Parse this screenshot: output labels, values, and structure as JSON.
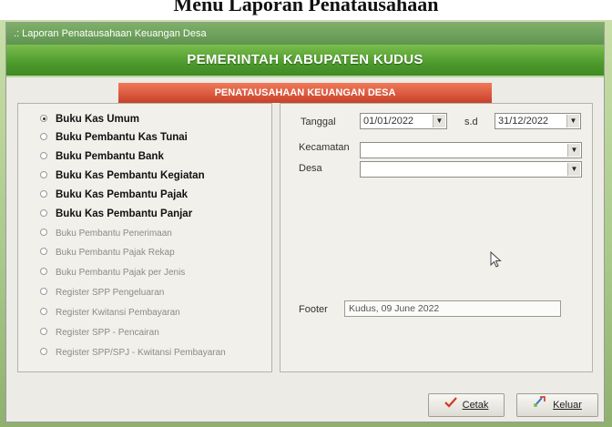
{
  "document_title": "Menu Laporan Penatausahaan",
  "window": {
    "title": ".: Laporan Penatausahaan Keuangan Desa",
    "banner": "PEMERINTAH KABUPATEN KUDUS",
    "subbanner": "PENATAUSAHAAN KEUANGAN DESA"
  },
  "report_options": [
    {
      "label": "Buku Kas Umum",
      "selected": true
    },
    {
      "label": "Buku Pembantu Kas Tunai",
      "selected": false
    },
    {
      "label": "Buku Pembantu Bank",
      "selected": false
    },
    {
      "label": "Buku Kas Pembantu Kegiatan",
      "selected": false
    },
    {
      "label": "Buku Kas Pembantu Pajak",
      "selected": false
    },
    {
      "label": "Buku Kas Pembantu Panjar",
      "selected": false
    },
    {
      "label": "Buku Pembantu Penerimaan",
      "selected": false
    },
    {
      "label": "Buku Pembantu Pajak Rekap",
      "selected": false
    },
    {
      "label": "Buku Pembantu Pajak per Jenis",
      "selected": false
    },
    {
      "label": "Register SPP Pengeluaran",
      "selected": false
    },
    {
      "label": "Register Kwitansi Pembayaran",
      "selected": false
    },
    {
      "label": "Register SPP - Pencairan",
      "selected": false
    },
    {
      "label": "Register SPP/SPJ - Kwitansi Pembayaran",
      "selected": false
    }
  ],
  "filters": {
    "tanggal_label": "Tanggal",
    "tanggal_from": "01/01/2022",
    "sd_label": "s.d",
    "tanggal_to": "31/12/2022",
    "kecamatan_label": "Kecamatan",
    "kecamatan_value": "",
    "desa_label": "Desa",
    "desa_value": "",
    "footer_label": "Footer",
    "footer_value": "Kudus, 09 June 2022"
  },
  "buttons": {
    "cetak": "Cetak",
    "keluar": "Keluar"
  },
  "icons": {
    "dropdown": "chevron-down-icon",
    "cetak": "check-icon",
    "keluar": "exit-icon"
  }
}
